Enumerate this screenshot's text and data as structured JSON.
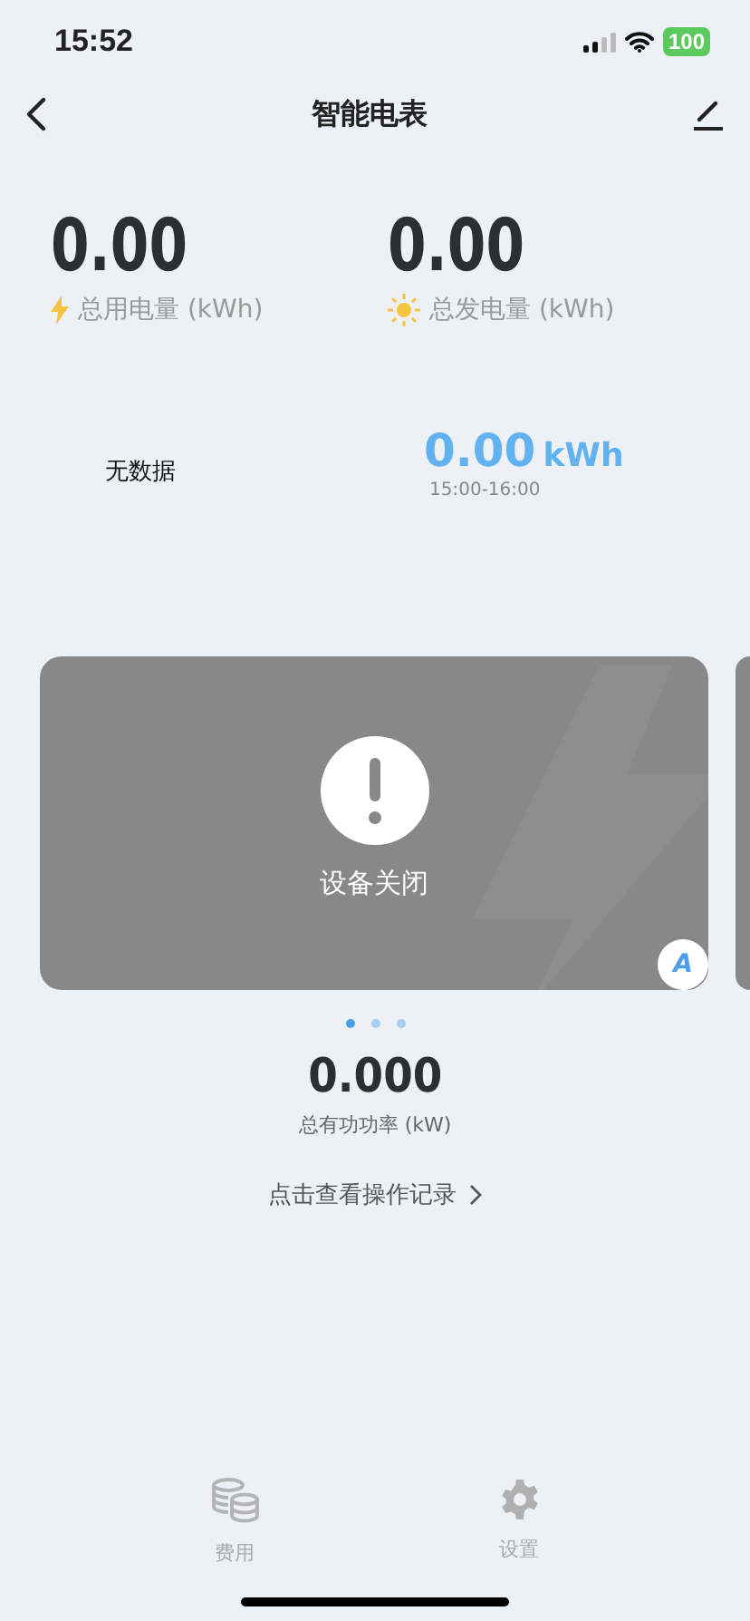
{
  "status_bar": {
    "time": "15:52",
    "battery": "100"
  },
  "nav": {
    "title": "智能电表"
  },
  "totals": [
    {
      "kind": "use",
      "value": "0.00",
      "label": "总用电量 (kWh)"
    },
    {
      "kind": "gen",
      "value": "0.00",
      "label": "总发电量 (kWh)"
    }
  ],
  "chart": {
    "empty_text": "无数据",
    "reading": "0.00",
    "unit": "kWh",
    "period": "15:00-16:00"
  },
  "device_card": {
    "status": "设备关闭",
    "badge": "A"
  },
  "pager": [
    {
      "selected": true
    },
    {
      "selected": false
    },
    {
      "selected": false
    }
  ],
  "power": {
    "value": "0.000",
    "label": "总有功功率 (kW)"
  },
  "log_link": "点击查看操作记录",
  "tabs": [
    {
      "kind": "cost",
      "label": "费用"
    },
    {
      "kind": "settings",
      "label": "设置"
    }
  ]
}
